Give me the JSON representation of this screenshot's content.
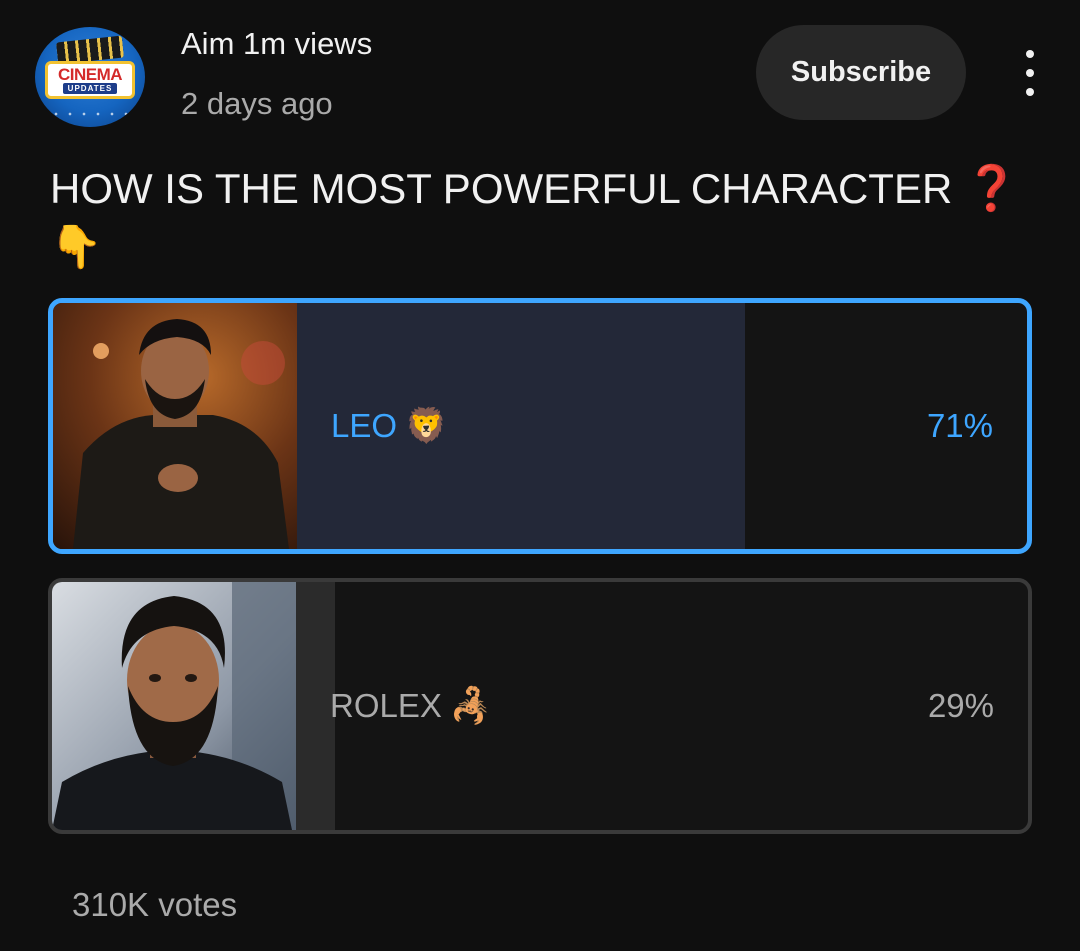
{
  "channel": {
    "name": "Aim 1m views",
    "time": "2 days ago",
    "avatar_text_top": "CINEMA",
    "avatar_text_bottom": "UPDATES"
  },
  "actions": {
    "subscribe_label": "Subscribe",
    "more_icon": "more-vertical-icon"
  },
  "post": {
    "question": "HOW IS THE MOST POWERFUL CHARACTER",
    "question_mark": "❓",
    "pointer_emoji": "👇"
  },
  "poll": {
    "options": [
      {
        "label": "LEO",
        "emoji": "🦁",
        "percent_label": "71%",
        "percent": 71,
        "selected": true
      },
      {
        "label": "ROLEX",
        "emoji": "🦂",
        "percent_label": "29%",
        "percent": 29,
        "selected": false
      }
    ],
    "votes_label": "310K votes"
  },
  "colors": {
    "background": "#0f0f0f",
    "accent": "#3ea6ff",
    "selected_fill": "#232838",
    "unselected_fill": "#2b2b2b"
  }
}
